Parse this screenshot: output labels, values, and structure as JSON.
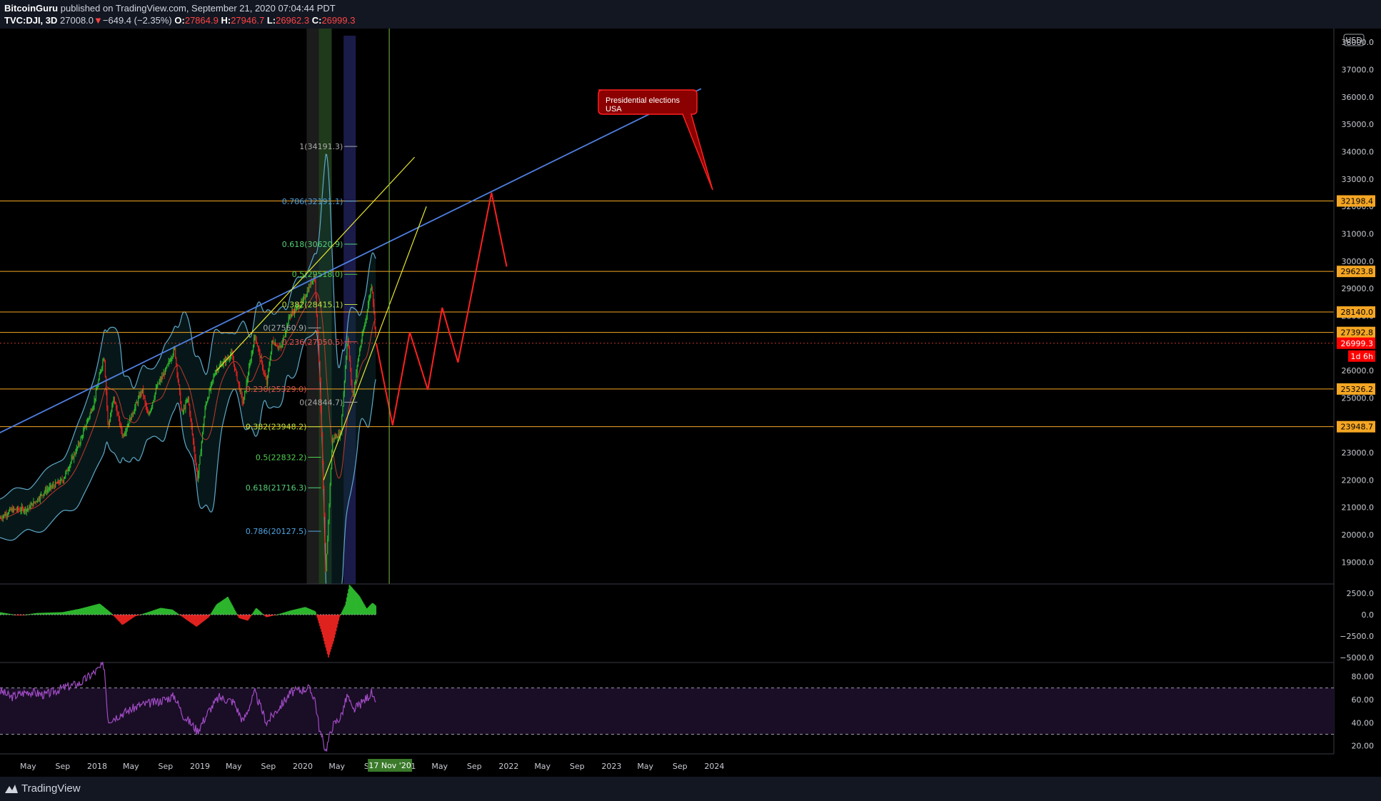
{
  "header": {
    "author": "BitcoinGuru",
    "published": "published on TradingView.com, September 21, 2020 07:04:44 PDT",
    "symbol": "TVC:DJI, 3D",
    "last": "27008.0",
    "change": "−649.4 (−2.35%)",
    "o_label": "O:",
    "o": "27864.9",
    "h_label": "H:",
    "h": "27946.7",
    "l_label": "L:",
    "l": "26962.3",
    "c_label": "C:",
    "c": "26999.3"
  },
  "footer": {
    "logo_text": "TradingView"
  },
  "currency": "USD",
  "annotation": {
    "line1": "Presidential elections",
    "line2": "USA"
  },
  "countdown": "1d 6h",
  "date_badge": "17 Nov '20",
  "colors": {
    "background": "#000000",
    "up": "#2db52d",
    "down": "#e0221f",
    "trendline_blue": "#4f7fe0",
    "trendline_yellow": "#e6e62e",
    "level_orange": "#f5a623",
    "forecast_red": "#ff2020",
    "bollinger": "#5fa8c8",
    "rsi": "#a04cc4"
  },
  "chart_data": {
    "type": "candlestick",
    "symbol": "TVC:DJI",
    "interval": "3D",
    "ylim": [
      18200,
      38500
    ],
    "y_ticks": [
      19000,
      20000,
      21000,
      22000,
      23000,
      24000,
      25000,
      26000,
      27000,
      28000,
      29000,
      30000,
      31000,
      32000,
      33000,
      34000,
      35000,
      36000,
      37000,
      38000
    ],
    "y_tick_labels": [
      "19000.0",
      "20000.0",
      "21000.0",
      "22000.0",
      "23000.0",
      "24000.0",
      "25000.0",
      "26000.0",
      "27000.0",
      "28000.0",
      "29000.0",
      "30000.0",
      "31000.0",
      "32000.0",
      "33000.0",
      "34000.0",
      "35000.0",
      "36000.0",
      "37000.0",
      "38000.0"
    ],
    "x_tick_labels": [
      "May",
      "Sep",
      "2018",
      "May",
      "Sep",
      "2019",
      "May",
      "Sep",
      "2020",
      "May",
      "Sep",
      "2021",
      "May",
      "Sep",
      "2022",
      "May",
      "Sep",
      "2023",
      "May",
      "Sep",
      "2024"
    ],
    "x_tick_dates": [
      "2017-05",
      "2017-09",
      "2018-01",
      "2018-05",
      "2018-09",
      "2019-01",
      "2019-05",
      "2019-09",
      "2020-01",
      "2020-05",
      "2020-09",
      "2021-01",
      "2021-05",
      "2021-09",
      "2022-01",
      "2022-05",
      "2022-09",
      "2023-01",
      "2023-05",
      "2023-09",
      "2024-01"
    ],
    "price_path": [
      [
        "2017-01-20",
        20600
      ],
      [
        "2017-03-01",
        20900
      ],
      [
        "2017-05-01",
        20950
      ],
      [
        "2017-07-01",
        21600
      ],
      [
        "2017-09-01",
        22000
      ],
      [
        "2017-11-01",
        23400
      ],
      [
        "2017-12-20",
        24800
      ],
      [
        "2018-01-26",
        26600
      ],
      [
        "2018-02-09",
        23900
      ],
      [
        "2018-03-01",
        25000
      ],
      [
        "2018-04-02",
        23600
      ],
      [
        "2018-05-01",
        24300
      ],
      [
        "2018-06-10",
        25300
      ],
      [
        "2018-07-01",
        24300
      ],
      [
        "2018-08-01",
        25400
      ],
      [
        "2018-09-01",
        26000
      ],
      [
        "2018-10-03",
        26800
      ],
      [
        "2018-10-29",
        24400
      ],
      [
        "2018-11-20",
        25000
      ],
      [
        "2018-12-24",
        22000
      ],
      [
        "2019-01-20",
        24700
      ],
      [
        "2019-02-25",
        26000
      ],
      [
        "2019-04-23",
        26600
      ],
      [
        "2019-06-03",
        24800
      ],
      [
        "2019-07-15",
        27300
      ],
      [
        "2019-08-26",
        25500
      ],
      [
        "2019-09-15",
        27100
      ],
      [
        "2019-10-15",
        26800
      ],
      [
        "2019-11-15",
        28000
      ],
      [
        "2019-12-31",
        28500
      ],
      [
        "2020-02-12",
        29500
      ],
      [
        "2020-03-01",
        26000
      ],
      [
        "2020-03-23",
        18600
      ],
      [
        "2020-04-15",
        23500
      ],
      [
        "2020-05-15",
        23700
      ],
      [
        "2020-06-08",
        27300
      ],
      [
        "2020-06-26",
        25000
      ],
      [
        "2020-07-20",
        26700
      ],
      [
        "2020-08-10",
        27800
      ],
      [
        "2020-09-02",
        29200
      ],
      [
        "2020-09-18",
        27000
      ]
    ],
    "last_price": 26999.3,
    "horizontal_levels": [
      32198.4,
      29623.8,
      28140.0,
      27392.8,
      25326.2,
      23948.7
    ],
    "horizontal_level_labels": [
      "32198.4",
      "29623.8",
      "28140.0",
      "27392.8",
      "25326.2",
      "23948.7"
    ],
    "last_price_label": "26999.3",
    "fib_upper": [
      {
        "label": "1(34191.3)",
        "value": 34191.3
      },
      {
        "label": "0.786(32191.1)",
        "value": 32191.1
      },
      {
        "label": "0.618(30620.9)",
        "value": 30620.9
      },
      {
        "label": "0.5(29518.0)",
        "value": 29518.0
      },
      {
        "label": "0.382(28415.1)",
        "value": 28415.1
      },
      {
        "label": "0.236(27050.5)",
        "value": 27050.5
      },
      {
        "label": "0(24844.7)",
        "value": 24844.7
      }
    ],
    "fib_lower": [
      {
        "label": "0(27560.9)",
        "value": 27560.9
      },
      {
        "label": "0.236(25329.0)",
        "value": 25329.0
      },
      {
        "label": "0.382(23948.2)",
        "value": 23948.2
      },
      {
        "label": "0.5(22832.2)",
        "value": 22832.2
      },
      {
        "label": "0.618(21716.3)",
        "value": 21716.3
      },
      {
        "label": "0.786(20127.5)",
        "value": 20127.5
      }
    ],
    "trendline_blue": [
      [
        "2017-01-15",
        23700
      ],
      [
        "2023-11-15",
        36300
      ]
    ],
    "trendline_yellow_upper": [
      [
        "2019-03-01",
        26000
      ],
      [
        "2021-02-01",
        33800
      ]
    ],
    "trendline_yellow_lower": [
      [
        "2020-03-15",
        22000
      ],
      [
        "2021-03-15",
        32000
      ]
    ],
    "forecast_path": [
      [
        "2020-09-18",
        27000
      ],
      [
        "2020-11-15",
        24000
      ],
      [
        "2021-01-15",
        27400
      ],
      [
        "2021-03-20",
        25300
      ],
      [
        "2021-05-10",
        28300
      ],
      [
        "2021-07-05",
        26300
      ],
      [
        "2021-11-01",
        32500
      ],
      [
        "2021-12-25",
        29800
      ]
    ],
    "election_line_date": "2020-11-03",
    "macd": {
      "ylim": [
        -5600,
        3600
      ],
      "y_ticks": [
        2500,
        0,
        -2500,
        -5000
      ],
      "y_tick_labels": [
        "2500.0",
        "0.0",
        "−2500.0",
        "−5000.0"
      ],
      "histogram_path": [
        [
          "2017-01-20",
          300
        ],
        [
          "2017-04-01",
          -100
        ],
        [
          "2017-06-01",
          200
        ],
        [
          "2017-09-01",
          300
        ],
        [
          "2017-11-01",
          700
        ],
        [
          "2018-01-10",
          1300
        ],
        [
          "2018-02-20",
          200
        ],
        [
          "2018-04-01",
          -1200
        ],
        [
          "2018-05-15",
          -200
        ],
        [
          "2018-07-01",
          300
        ],
        [
          "2018-08-15",
          800
        ],
        [
          "2018-09-25",
          600
        ],
        [
          "2018-11-15",
          -600
        ],
        [
          "2018-12-20",
          -1400
        ],
        [
          "2019-02-01",
          -300
        ],
        [
          "2019-03-01",
          1200
        ],
        [
          "2019-04-10",
          2100
        ],
        [
          "2019-05-20",
          -400
        ],
        [
          "2019-06-20",
          -700
        ],
        [
          "2019-07-20",
          800
        ],
        [
          "2019-08-25",
          -300
        ],
        [
          "2019-10-01",
          0
        ],
        [
          "2019-11-20",
          500
        ],
        [
          "2020-01-10",
          900
        ],
        [
          "2020-02-15",
          400
        ],
        [
          "2020-03-10",
          -2200
        ],
        [
          "2020-04-01",
          -5000
        ],
        [
          "2020-04-20",
          -3000
        ],
        [
          "2020-05-10",
          -300
        ],
        [
          "2020-06-01",
          1200
        ],
        [
          "2020-06-15",
          3500
        ],
        [
          "2020-07-20",
          2200
        ],
        [
          "2020-08-15",
          700
        ],
        [
          "2020-09-05",
          1400
        ],
        [
          "2020-09-18",
          1000
        ]
      ]
    },
    "rsi": {
      "ylim": [
        13,
        92
      ],
      "y_ticks": [
        80,
        60,
        40,
        20
      ],
      "y_tick_labels": [
        "80.00",
        "60.00",
        "40.00",
        "20.00"
      ],
      "band": [
        30,
        70
      ],
      "path": [
        [
          "2017-01-20",
          68
        ],
        [
          "2017-03-01",
          62
        ],
        [
          "2017-05-01",
          67
        ],
        [
          "2017-07-01",
          64
        ],
        [
          "2017-09-01",
          70
        ],
        [
          "2017-11-01",
          74
        ],
        [
          "2018-01-26",
          90
        ],
        [
          "2018-02-09",
          42
        ],
        [
          "2018-04-01",
          48
        ],
        [
          "2018-06-01",
          55
        ],
        [
          "2018-08-01",
          58
        ],
        [
          "2018-10-03",
          63
        ],
        [
          "2018-11-01",
          47
        ],
        [
          "2018-12-24",
          33
        ],
        [
          "2019-02-01",
          50
        ],
        [
          "2019-03-10",
          62
        ],
        [
          "2019-05-01",
          58
        ],
        [
          "2019-06-03",
          41
        ],
        [
          "2019-07-15",
          66
        ],
        [
          "2019-08-26",
          40
        ],
        [
          "2019-10-15",
          55
        ],
        [
          "2019-11-20",
          66
        ],
        [
          "2020-01-20",
          70
        ],
        [
          "2020-02-12",
          62
        ],
        [
          "2020-03-01",
          33
        ],
        [
          "2020-03-23",
          16
        ],
        [
          "2020-04-15",
          37
        ],
        [
          "2020-05-15",
          45
        ],
        [
          "2020-06-08",
          64
        ],
        [
          "2020-06-26",
          50
        ],
        [
          "2020-08-01",
          58
        ],
        [
          "2020-09-02",
          66
        ],
        [
          "2020-09-18",
          52
        ]
      ]
    }
  }
}
